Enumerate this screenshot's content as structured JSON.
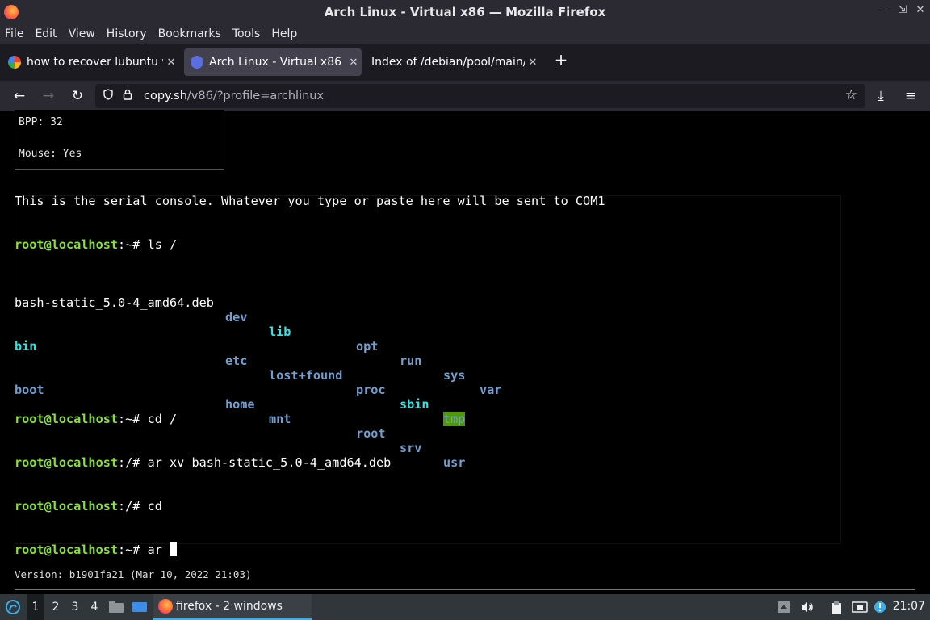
{
  "window": {
    "title": "Arch Linux - Virtual x86 — Mozilla Firefox",
    "min_glyph": "–",
    "restore_glyph": "⇲",
    "close_glyph": "✕"
  },
  "menu": [
    "File",
    "Edit",
    "View",
    "History",
    "Bookmarks",
    "Tools",
    "Help"
  ],
  "tabs": [
    {
      "label": "how to recover lubuntu w",
      "close": "✕",
      "icon": "google-icon"
    },
    {
      "label": "Arch Linux - Virtual x86",
      "close": "✕",
      "icon": "v86-icon"
    },
    {
      "label": "Index of /debian/pool/main/b",
      "close": "✕",
      "icon": "none"
    }
  ],
  "newtab_glyph": "+",
  "nav": {
    "back_glyph": "←",
    "forward_glyph": "→",
    "reload_glyph": "↻",
    "url_host": "copy.sh",
    "url_rest": "/v86/?profile=archlinux",
    "star_glyph": "☆",
    "download_glyph": "⤓",
    "menu_glyph": "≡"
  },
  "infobox": {
    "bpp": "BPP: 32",
    "mouse": "Mouse: Yes"
  },
  "serial": {
    "header": "This is the serial console. Whatever you type or paste here will be sent to COM1",
    "lines": {
      "l1_prompt": "root@localhost",
      "l1_rest": ":~# ls /",
      "ls_r1": {
        "c1": "bash-static_5.0-4_amd64.deb",
        "c2": "dev",
        "c3": "lib",
        "c4": "opt",
        "c5": "run",
        "c6": "sys",
        "c7": "var"
      },
      "ls_r2": {
        "c1": "bin",
        "c2": "etc",
        "c3": "lost+found",
        "c4": "proc",
        "c5": "sbin",
        "c6": "tmp"
      },
      "ls_r3": {
        "c1": "boot",
        "c2": "home",
        "c3": "mnt",
        "c4": "root",
        "c5": "srv",
        "c6": "usr"
      },
      "l5_prompt": "root@localhost",
      "l5_rest": ":~# cd /",
      "l6_prompt": "root@localhost",
      "l6_rest": ":/# ar xv bash-static_5.0-4_amd64.deb",
      "l7_prompt": "root@localhost",
      "l7_rest": ":/# cd",
      "l8_prompt": "root@localhost",
      "l8_rest": ":~# ar "
    }
  },
  "version": "Version: b1901fa21 (Mar 10, 2022 21:03)",
  "taskbar": {
    "workspaces": [
      "1",
      "2",
      "3",
      "4"
    ],
    "task_label": "firefox - 2 windows",
    "clock": "21:07"
  }
}
